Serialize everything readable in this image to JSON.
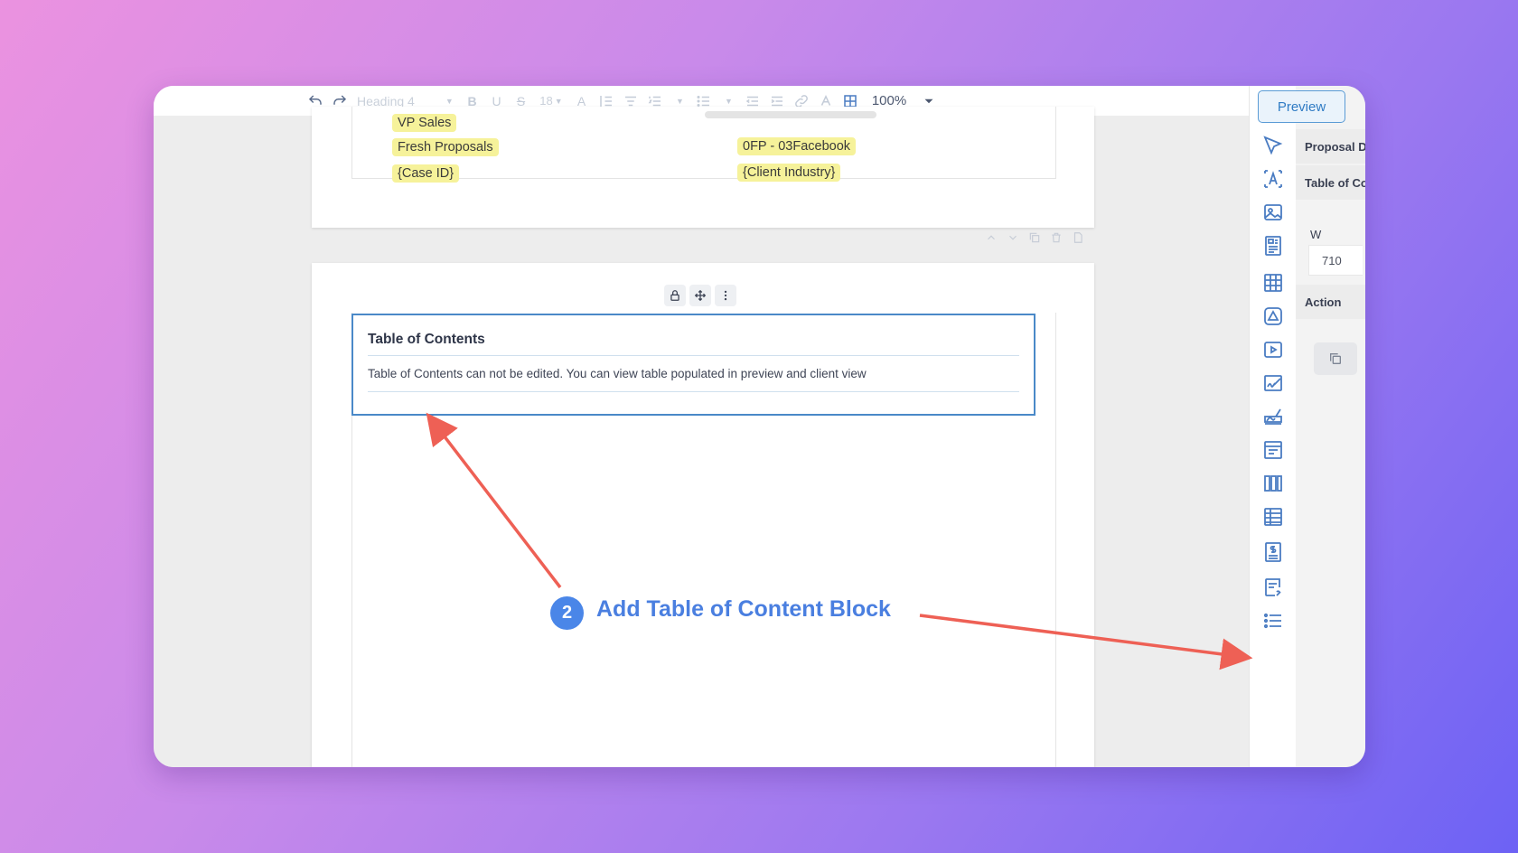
{
  "toolbar": {
    "heading_style": "Heading 4",
    "font_size": "18",
    "zoom": "100%"
  },
  "preview_button": "Preview",
  "page1": {
    "tags_left": [
      "VP Sales",
      "Fresh Proposals",
      "{Case ID}"
    ],
    "tags_right": [
      "0FP - 03Facebook",
      "{Client Industry}"
    ]
  },
  "toc_block": {
    "title": "Table of Contents",
    "message": "Table of Contents can not be edited. You can view table populated in preview and client view"
  },
  "side_panel": {
    "rows": [
      "Proposal D",
      "Table of Co"
    ],
    "width_label": "W",
    "width_value": "710",
    "action_label": "Action"
  },
  "annotation": {
    "step_number": "2",
    "step_text": "Add Table of Content Block",
    "arrow_color": "#ee6055"
  },
  "colors": {
    "accent": "#4a86e8",
    "icon_blue": "#4a7cc2",
    "tag_yellow": "#f6f29a",
    "toc_border": "#4a89c8"
  },
  "icons": [
    "undo-icon",
    "redo-icon",
    "bold-icon",
    "underline-icon",
    "strikethrough-icon",
    "text-color-icon",
    "line-height-icon",
    "align-icon",
    "numbered-list-icon",
    "bullet-list-icon",
    "outdent-icon",
    "indent-icon",
    "link-icon",
    "clear-format-icon",
    "table-icon",
    "chevron-down-icon"
  ]
}
